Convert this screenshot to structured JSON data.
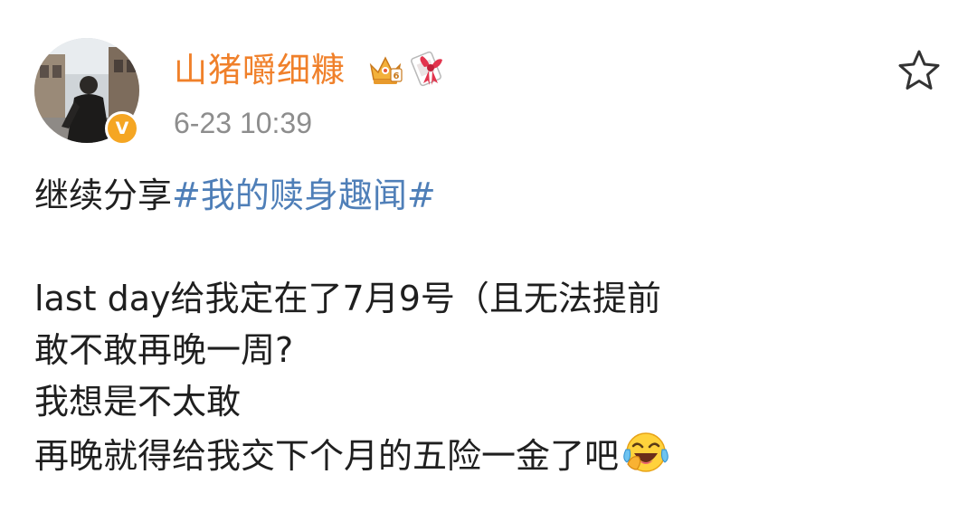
{
  "post": {
    "author": {
      "username": "山猪嚼细糠",
      "verified_badge_text": "V",
      "avatar_icon": "user-avatar-photo",
      "badges": [
        "crown-badge-icon",
        "ribbon-badge-icon"
      ]
    },
    "timestamp": "6-23 10:39",
    "favorite_icon": "star-outline-icon",
    "content": {
      "line1_prefix": "继续分享",
      "hashtag": "#我的赎身趣闻#",
      "line2": "last day给我定在了7月9号（且无法提前",
      "line3": "敢不敢再晚一周?",
      "line4": "我想是不太敢",
      "line5": "再晚就得给我交下个月的五险一金了吧",
      "end_emoji": "laughing-crying-emoji"
    }
  },
  "colors": {
    "username": "#f0802a",
    "hashtag": "#4f7fb8",
    "timestamp": "#8d8d8d",
    "verified": "#f5a623",
    "text": "#1f1f1f"
  }
}
